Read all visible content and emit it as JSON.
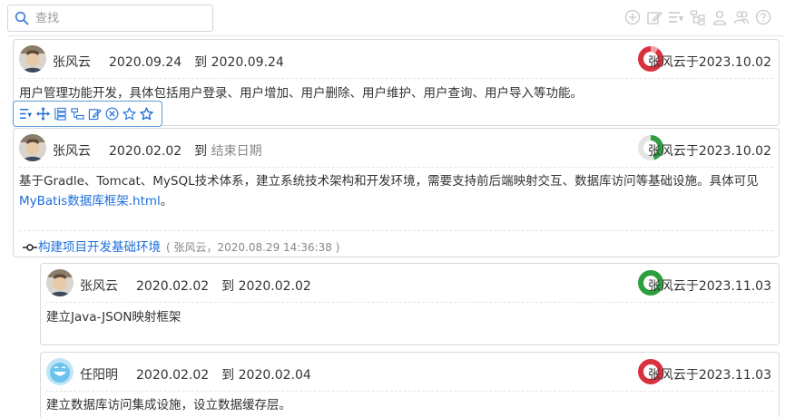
{
  "search": {
    "placeholder": "查找",
    "value": ""
  },
  "toolbar": {
    "icons": [
      "add-circle-icon",
      "edit-icon",
      "list-sort-icon",
      "tree-icon",
      "user-icon",
      "users-icon",
      "help-icon"
    ]
  },
  "row_toolbar": {
    "icons": [
      "list-sort-icon",
      "move-icon",
      "indent-icon",
      "outdent-icon",
      "edit-icon",
      "delete-circle-icon",
      "star-outline-icon",
      "star-icon"
    ]
  },
  "tasks": [
    {
      "owner": "张风云",
      "start": "2020.09.24",
      "to": "到",
      "end": "2020.09.24",
      "updated": "张风云于2023.10.02",
      "progress": 0.1,
      "progress_color": "#d9313e",
      "description": "用户管理功能开发，具体包括用户登录、用户增加、用户删除、用户维护、用户查询、用户导入等功能。"
    },
    {
      "owner": "张风云",
      "start": "2020.02.02",
      "to": "到",
      "end": "结束日期",
      "updated": "张风云于2023.10.02",
      "progress": 0.45,
      "progress_color": "#2e9e3e",
      "description_text": "基于Gradle、Tomcat、MySQL技术体系，建立系统技术架构和开发环境，需要支持前后端映射交互、数据库访问等基础设施。具体可见",
      "description_link": "MyBatis数据库框架.html",
      "description_end": "。",
      "commit_link": "构建项目开发基础环境",
      "commit_info": "( 张风云，2020.08.29 14:36:38 )"
    },
    {
      "owner": "张风云",
      "start": "2020.02.02",
      "to": "到",
      "end": "2020.02.02",
      "updated": "张风云于2023.11.03",
      "progress": 1.0,
      "progress_color": "#2e9e3e",
      "description": "建立Java-JSON映射框架"
    },
    {
      "owner": "任阳明",
      "start": "2020.02.02",
      "to": "到",
      "end": "2020.02.04",
      "updated": "张风云于2023.11.03",
      "progress": 0.0,
      "progress_color": "#d9313e",
      "description": "建立数据库访问集成设施，设立数据缓存层。"
    }
  ]
}
